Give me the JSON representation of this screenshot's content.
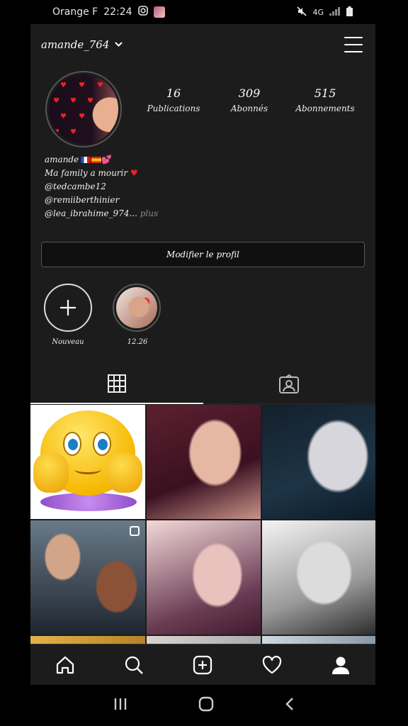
{
  "status_bar": {
    "carrier": "Orange F",
    "time": "22:24",
    "network": "4G"
  },
  "header": {
    "username": "amande_764",
    "dropdown_icon": "chevron-down-icon",
    "menu_icon": "hamburger-menu-icon"
  },
  "profile": {
    "avatar_icon": "profile-avatar",
    "stats": [
      {
        "value": "16",
        "label": "Publications"
      },
      {
        "value": "309",
        "label": "Abonnés"
      },
      {
        "value": "515",
        "label": "Abonnements"
      }
    ],
    "bio": {
      "name": "amande",
      "line2": "Ma family a mourir",
      "line3": "@tedcambe12",
      "line4": "@remiiberthinier",
      "line5": "@lea_ibrahime_974...",
      "more": "plus"
    },
    "edit_button": "Modifier le profil"
  },
  "highlights": [
    {
      "label": "Nouveau",
      "icon": "plus-icon"
    },
    {
      "label": "12.26",
      "icon": "highlight-photo"
    }
  ],
  "tabs": [
    {
      "name": "grid-icon",
      "active": true
    },
    {
      "name": "tagged-icon",
      "active": false
    }
  ],
  "bottom_nav": [
    "home-icon",
    "search-icon",
    "add-post-icon",
    "heart-icon",
    "profile-icon"
  ],
  "colors": {
    "background": "#1c1c1c",
    "text": "#ffffff",
    "heart": "#e22222"
  }
}
